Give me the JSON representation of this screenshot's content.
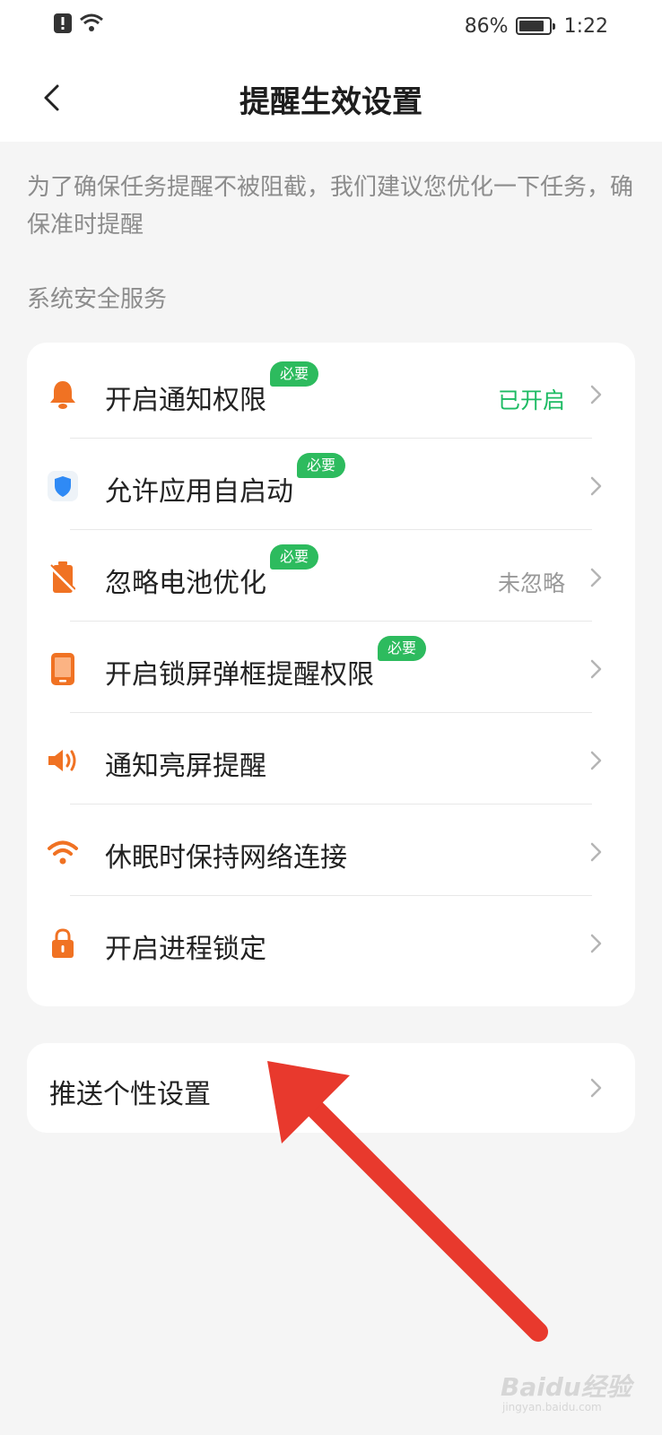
{
  "status_bar": {
    "battery": "86%",
    "time": "1:22"
  },
  "header": {
    "title": "提醒生效设置"
  },
  "intro_text": "为了确保任务提醒不被阻截，我们建议您优化一下任务，确保准时提醒",
  "section_title": "系统安全服务",
  "settings": [
    {
      "label": "开启通知权限",
      "badge": "必要",
      "status": "已开启",
      "icon": "bell-icon"
    },
    {
      "label": "允许应用自启动",
      "badge": "必要",
      "status": "",
      "icon": "shield-icon"
    },
    {
      "label": "忽略电池优化",
      "badge": "必要",
      "status": "未忽略",
      "icon": "battery-icon"
    },
    {
      "label": "开启锁屏弹框提醒权限",
      "badge": "必要",
      "status": "",
      "icon": "phone-icon"
    },
    {
      "label": "通知亮屏提醒",
      "badge": "",
      "status": "",
      "icon": "speaker-icon"
    },
    {
      "label": "休眠时保持网络连接",
      "badge": "",
      "status": "",
      "icon": "wifi-icon"
    },
    {
      "label": "开启进程锁定",
      "badge": "",
      "status": "",
      "icon": "lock-icon"
    }
  ],
  "push": {
    "label": "推送个性设置"
  },
  "watermark": {
    "brand": "Baidu经验",
    "url": "jingyan.baidu.com"
  },
  "colors": {
    "accent_orange": "#f07223",
    "badge_green": "#2dbb5e",
    "status_green": "#1dbb63",
    "annotation_red": "#e8392d"
  }
}
